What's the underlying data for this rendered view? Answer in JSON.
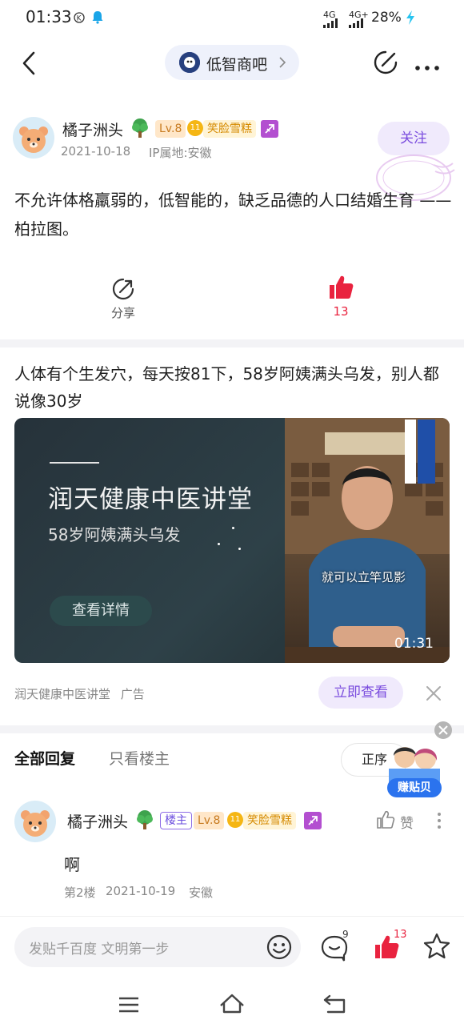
{
  "status_bar": {
    "time": "01:33",
    "net1": "4G",
    "net2": "4G+",
    "battery": "28%"
  },
  "nav": {
    "forum_name": "低智商吧"
  },
  "post": {
    "author": "橘子洲头",
    "level": "Lv.8",
    "medal_num": "11",
    "medal_text": "笑脸雪糕",
    "date": "2021-10-18",
    "ip": "IP属地:安徽",
    "follow_label": "关注",
    "text": "不允许体格羸弱的，低智能的，缺乏品德的人口结婚生育 —— 柏拉图。",
    "share_label": "分享",
    "like_count": "13"
  },
  "ad": {
    "title": "人体有个生发穴，每天按81下，58岁阿姨满头乌发，别人都说像30岁",
    "card_title": "润天健康中医讲堂",
    "card_subtitle": "58岁阿姨满头乌发",
    "card_cta": "查看详情",
    "video_caption": "就可以立竿见影",
    "video_duration": "01:31",
    "source": "润天健康中医讲堂",
    "ad_tag": "广告",
    "action_label": "立即查看"
  },
  "replies_header": {
    "tab_all": "全部回复",
    "tab_op": "只看楼主",
    "sort_label": "正序",
    "promo_label": "赚贴贝"
  },
  "reply": {
    "author": "橘子洲头",
    "op_badge": "楼主",
    "level": "Lv.8",
    "medal_num": "11",
    "medal_text": "笑脸雪糕",
    "like_label": "赞",
    "text": "啊",
    "floor": "第2楼",
    "date": "2021-10-19",
    "location": "安徽"
  },
  "bottom": {
    "input_placeholder": "发贴千百度 文明第一步",
    "comment_count": "9",
    "like_count": "13"
  },
  "colors": {
    "accent_purple": "#7a4cde",
    "like_red": "#e9233f"
  }
}
